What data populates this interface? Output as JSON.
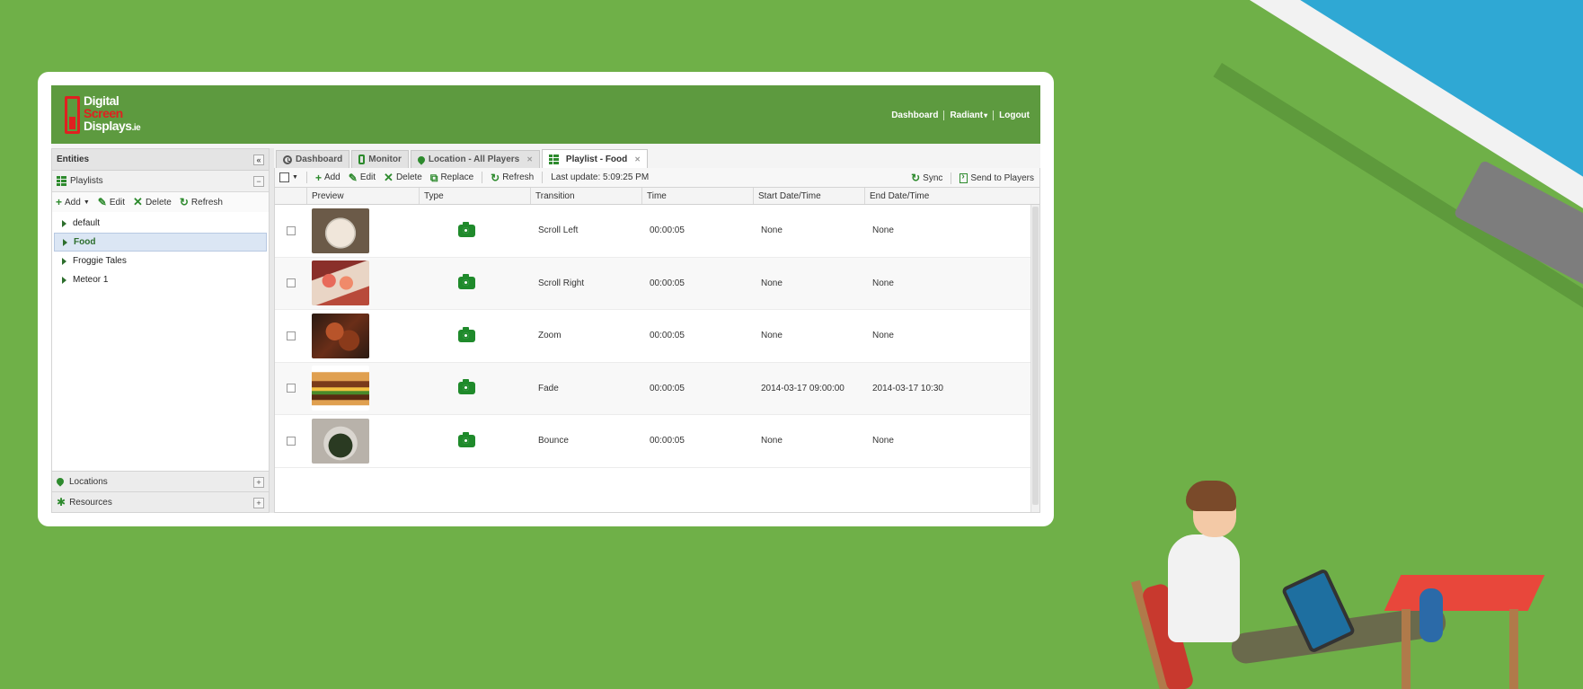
{
  "header": {
    "logo": {
      "line1": "Digital",
      "line2": "Screen",
      "line3": "Displays",
      "suffix": ".ie"
    },
    "nav": [
      "Dashboard",
      "Radiant",
      "Logout"
    ],
    "nav_dropdown_indicator": "▾"
  },
  "sidebar": {
    "title": "Entities",
    "collapse_glyph": "«",
    "playlists": {
      "title": "Playlists",
      "toggle_glyph": "−",
      "toolbar": {
        "add": "Add",
        "edit": "Edit",
        "delete": "Delete",
        "refresh": "Refresh"
      },
      "items": [
        {
          "label": "default",
          "active": false
        },
        {
          "label": "Food",
          "active": true
        },
        {
          "label": "Froggie Tales",
          "active": false
        },
        {
          "label": "Meteor 1",
          "active": false
        }
      ]
    },
    "locations": {
      "title": "Locations",
      "toggle_glyph": "+"
    },
    "resources": {
      "title": "Resources",
      "toggle_glyph": "+"
    }
  },
  "tabs": [
    {
      "label": "Dashboard",
      "icon": "clock-icon",
      "closable": false,
      "active": false
    },
    {
      "label": "Monitor",
      "icon": "phone-icon",
      "closable": false,
      "active": false
    },
    {
      "label": "Location - All Players",
      "icon": "location-pin-icon",
      "closable": true,
      "active": false
    },
    {
      "label": "Playlist - Food",
      "icon": "grid-icon",
      "closable": true,
      "active": true
    }
  ],
  "toolbar": {
    "add": "Add",
    "edit": "Edit",
    "delete": "Delete",
    "replace": "Replace",
    "refresh": "Refresh",
    "last_update": "Last update: 5:09:25 PM",
    "sync": "Sync",
    "send_to_players": "Send to Players"
  },
  "grid": {
    "columns": [
      "Preview",
      "Type",
      "Transition",
      "Time",
      "Start Date/Time",
      "End Date/Time"
    ],
    "rows": [
      {
        "type_icon": "camera-icon",
        "transition": "Scroll Left",
        "time": "00:00:05",
        "start": "None",
        "end": "None"
      },
      {
        "type_icon": "camera-icon",
        "transition": "Scroll Right",
        "time": "00:00:05",
        "start": "None",
        "end": "None"
      },
      {
        "type_icon": "camera-icon",
        "transition": "Zoom",
        "time": "00:00:05",
        "start": "None",
        "end": "None"
      },
      {
        "type_icon": "camera-icon",
        "transition": "Fade",
        "time": "00:00:05",
        "start": "2014-03-17 09:00:00",
        "end": "2014-03-17 10:30:"
      },
      {
        "type_icon": "camera-icon",
        "transition": "Bounce",
        "time": "00:00:05",
        "start": "None",
        "end": "None"
      }
    ]
  },
  "colors": {
    "background": "#6fb048",
    "header": "#5d9a3f",
    "accent_green": "#2d8a2d",
    "logo_red": "#e02020"
  }
}
